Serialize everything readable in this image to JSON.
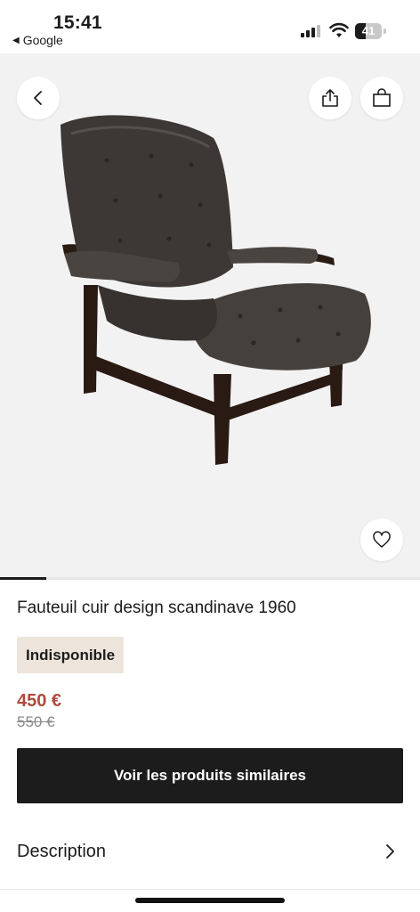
{
  "status_bar": {
    "time": "15:41",
    "back_app": "Google",
    "back_glyph": "◀",
    "battery_level": "41",
    "battery_fraction": 0.41
  },
  "product_image": {
    "carousel_progress": 0.11,
    "icons": {
      "back": "chevron-left-icon",
      "share": "share-icon",
      "bag": "shopping-bag-icon",
      "favorite": "heart-icon"
    }
  },
  "product": {
    "title": "Fauteuil cuir design scandinave 1960",
    "availability": "Indisponible",
    "price": "450 €",
    "old_price": "550 €"
  },
  "actions": {
    "similar_button": "Voir les produits similaires"
  },
  "sections": {
    "description_label": "Description"
  },
  "colors": {
    "price": "#b04a3c",
    "badge_bg": "#ede5dc",
    "cta_bg": "#1c1c1c",
    "image_bg": "#f2f2f2"
  }
}
